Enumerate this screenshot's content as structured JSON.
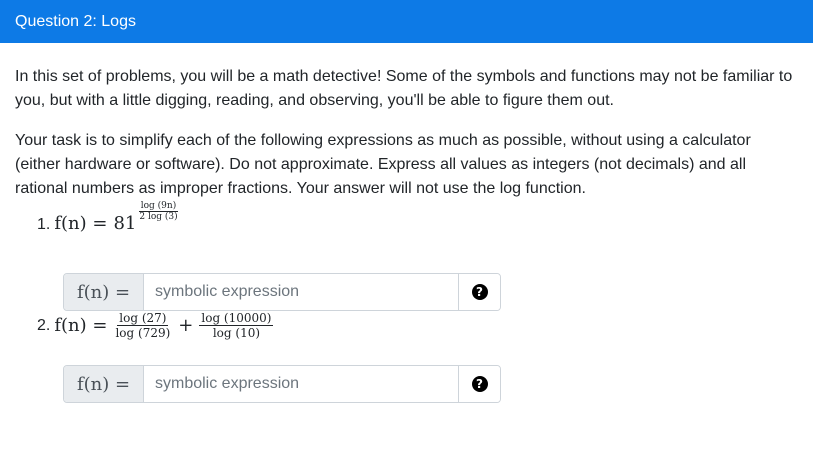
{
  "header": {
    "title": "Question 2: Logs"
  },
  "intro": {
    "p1": "In this set of problems, you will be a math detective! Some of the symbols and functions may not be familiar to you, but with a little digging, reading, and observing, you'll be able to figure them out.",
    "p2": "Your task is to simplify each of the following expressions as much as possible, without using a calculator (either hardware or software). Do not approximate. Express all values as integers (not decimals) and all rational numbers as improper fractions. Your answer will not use the log function."
  },
  "problems": [
    {
      "number": "1.",
      "lhs": "f(n) =",
      "base": "81",
      "exp_num": "log (9n)",
      "exp_den": "2 log (3)",
      "input_label": "f(n) =",
      "placeholder": "symbolic expression",
      "help_icon": "question-circle-icon"
    },
    {
      "number": "2.",
      "lhs": "f(n) =",
      "frac1_num": "log (27)",
      "frac1_den": "log (729)",
      "plus": "+",
      "frac2_num": "log (10000)",
      "frac2_den": "log (10)",
      "input_label": "f(n) =",
      "placeholder": "symbolic expression",
      "help_icon": "question-circle-icon"
    }
  ]
}
